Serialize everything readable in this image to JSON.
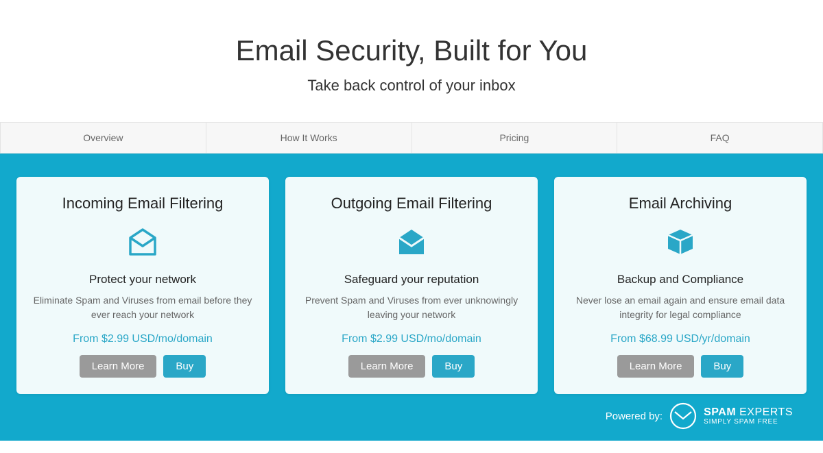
{
  "hero": {
    "title": "Email Security, Built for You",
    "subtitle": "Take back control of your inbox"
  },
  "tabs": [
    {
      "label": "Overview"
    },
    {
      "label": "How It Works"
    },
    {
      "label": "Pricing"
    },
    {
      "label": "FAQ"
    }
  ],
  "cards": [
    {
      "title": "Incoming Email Filtering",
      "subtitle": "Protect your network",
      "description": "Eliminate Spam and Viruses from email before they ever reach your network",
      "price": "From $2.99 USD/mo/domain",
      "learn_label": "Learn More",
      "buy_label": "Buy"
    },
    {
      "title": "Outgoing Email Filtering",
      "subtitle": "Safeguard your reputation",
      "description": "Prevent Spam and Viruses from ever unknowingly leaving your network",
      "price": "From $2.99 USD/mo/domain",
      "learn_label": "Learn More",
      "buy_label": "Buy"
    },
    {
      "title": "Email Archiving",
      "subtitle": "Backup and Compliance",
      "description": "Never lose an email again and ensure email data integrity for legal compliance",
      "price": "From $68.99 USD/yr/domain",
      "learn_label": "Learn More",
      "buy_label": "Buy"
    }
  ],
  "footer": {
    "powered_by": "Powered by:",
    "brand_bold": "SPAM",
    "brand_rest": " EXPERTS",
    "tagline": "SIMPLY SPAM FREE"
  }
}
